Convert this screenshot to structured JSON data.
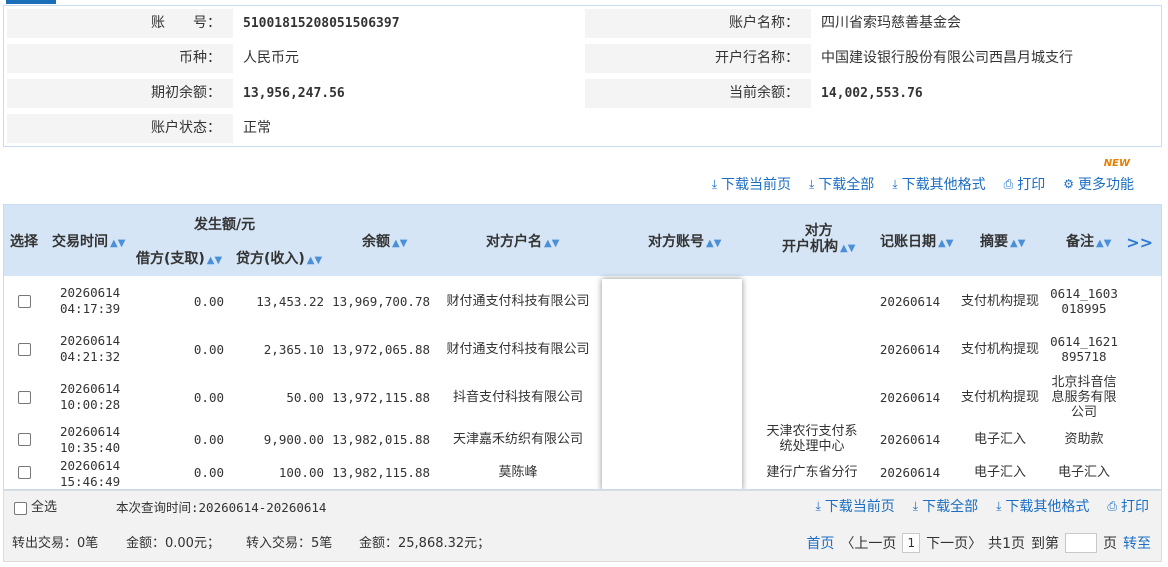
{
  "account": {
    "account_no_label": "账　　号：",
    "account_no": "51001815208051506397",
    "account_name_label": "账户名称：",
    "account_name": "四川省索玛慈善基金会",
    "currency_label": "币种：",
    "currency": "人民币元",
    "bank_label": "开户行名称：",
    "bank": "中国建设银行股份有限公司西昌月城支行",
    "opening_balance_label": "期初余额：",
    "opening_balance": "13,956,247.56",
    "current_balance_label": "当前余额：",
    "current_balance": "14,002,553.76",
    "status_label": "账户状态：",
    "status": "正常"
  },
  "toolbar": {
    "download_page": "下载当前页",
    "download_all": "下载全部",
    "download_other": "下载其他格式",
    "print": "打印",
    "more": "更多功能",
    "new_badge": "NEW"
  },
  "table": {
    "headers": {
      "select": "选择",
      "time": "交易时间",
      "amount_group": "发生额/元",
      "debit": "借方(支取)",
      "credit": "贷方(收入)",
      "balance": "余额",
      "counterparty_name": "对方户名",
      "counterparty_account": "对方账号",
      "counterparty_bank_line1": "对方",
      "counterparty_bank_line2": "开户机构",
      "post_date": "记账日期",
      "summary": "摘要",
      "remark": "备注",
      "more": ">>"
    },
    "rows": [
      {
        "date": "20260614",
        "time": "04:17:39",
        "debit": "0.00",
        "credit": "13,453.22",
        "balance": "13,969,700.78",
        "name": "财付通支付科技有限公司",
        "bank": "",
        "post_date": "20260614",
        "summary": "支付机构提现",
        "remark": "0614_1603018995"
      },
      {
        "date": "20260614",
        "time": "04:21:32",
        "debit": "0.00",
        "credit": "2,365.10",
        "balance": "13,972,065.88",
        "name": "财付通支付科技有限公司",
        "bank": "",
        "post_date": "20260614",
        "summary": "支付机构提现",
        "remark": "0614_1621895718"
      },
      {
        "date": "20260614",
        "time": "10:00:28",
        "debit": "0.00",
        "credit": "50.00",
        "balance": "13,972,115.88",
        "name": "抖音支付科技有限公司",
        "bank": "",
        "post_date": "20260614",
        "summary": "支付机构提现",
        "remark": "北京抖音信息服务有限公司"
      },
      {
        "date": "20260614",
        "time": "10:35:40",
        "debit": "0.00",
        "credit": "9,900.00",
        "balance": "13,982,015.88",
        "name": "天津嘉禾纺织有限公司",
        "bank": "天津农行支付系统处理中心",
        "post_date": "20260614",
        "summary": "电子汇入",
        "remark": "资助款"
      },
      {
        "date": "20260614",
        "time": "15:46:49",
        "debit": "0.00",
        "credit": "100.00",
        "balance": "13,982,115.88",
        "name": "莫陈峰",
        "bank": "建行广东省分行",
        "post_date": "20260614",
        "summary": "电子汇入",
        "remark": "电子汇入"
      }
    ]
  },
  "footer": {
    "select_all": "全选",
    "query_time": "本次查询时间:20260614-20260614",
    "download_page": "下载当前页",
    "download_all": "下载全部",
    "download_other": "下载其他格式",
    "print": "打印",
    "out_tx": "转出交易：0笔",
    "out_amount": "金额：0.00元；",
    "in_tx": "转入交易：5笔",
    "in_amount": "金额：25,868.32元；",
    "first": "首页",
    "prev": "〈上一页",
    "current_page": "1",
    "next": "下一页〉",
    "total": "共1页",
    "goto_prefix": "到第",
    "goto_suffix": "页",
    "goto_button": "转至"
  }
}
